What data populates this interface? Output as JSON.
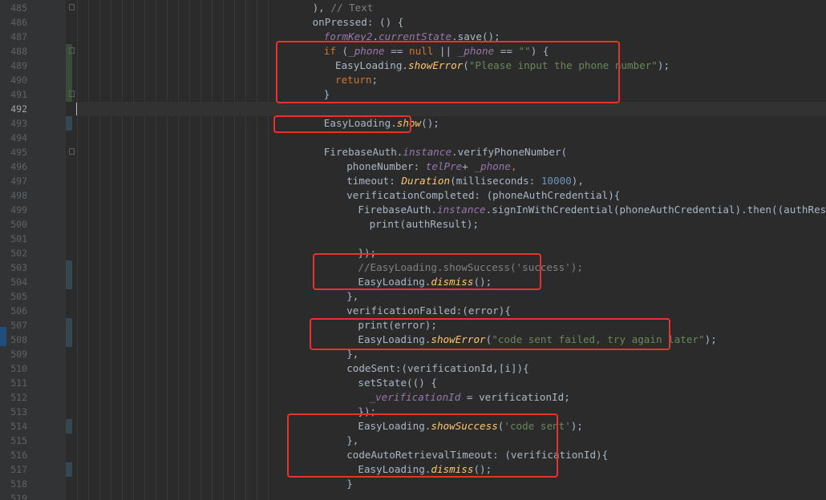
{
  "colors": {
    "default": "#a9b7c6",
    "keyword": "#cc7832",
    "string": "#6a8759",
    "number": "#6897bb",
    "comment": "#808080",
    "static_member": "#9876aa",
    "static_call": "#ffc66d",
    "param_name": "#a9b7c6",
    "highlight_box": "#e8332c"
  },
  "editor": {
    "language": "dart",
    "highlight_boxes": 6,
    "lines": [
      {
        "number": "485",
        "indent": 6,
        "tokens": [
          {
            "t": "), ",
            "k": "default"
          },
          {
            "t": "// Text",
            "k": "comment"
          }
        ]
      },
      {
        "number": "486",
        "indent": 6,
        "tokens": [
          {
            "t": "onPressed: () {",
            "k": "default"
          }
        ]
      },
      {
        "number": "487",
        "indent": 8,
        "tokens": [
          {
            "t": "formKey2",
            "k": "static_member"
          },
          {
            "t": ".",
            "k": "default"
          },
          {
            "t": "currentState",
            "k": "static_member"
          },
          {
            "t": ".save();",
            "k": "default"
          }
        ]
      },
      {
        "number": "488",
        "indent": 8,
        "tokens": [
          {
            "t": "if",
            "k": "keyword"
          },
          {
            "t": " (",
            "k": "default"
          },
          {
            "t": "_phone",
            "k": "static_member"
          },
          {
            "t": " == ",
            "k": "default"
          },
          {
            "t": "null",
            "k": "keyword"
          },
          {
            "t": " || ",
            "k": "default"
          },
          {
            "t": "_phone",
            "k": "static_member"
          },
          {
            "t": " == ",
            "k": "default"
          },
          {
            "t": "\"\"",
            "k": "string"
          },
          {
            "t": ") {",
            "k": "default"
          }
        ]
      },
      {
        "number": "489",
        "indent": 10,
        "tokens": [
          {
            "t": "EasyLoading.",
            "k": "default"
          },
          {
            "t": "showError",
            "k": "static_call"
          },
          {
            "t": "(",
            "k": "default"
          },
          {
            "t": "\"Please input the phone number\"",
            "k": "string"
          },
          {
            "t": ");",
            "k": "default"
          }
        ]
      },
      {
        "number": "490",
        "indent": 10,
        "tokens": [
          {
            "t": "return",
            "k": "keyword"
          },
          {
            "t": ";",
            "k": "default"
          }
        ]
      },
      {
        "number": "491",
        "indent": 8,
        "tokens": [
          {
            "t": "}",
            "k": "default"
          }
        ]
      },
      {
        "number": "492",
        "indent": 0,
        "tokens": [],
        "current": true
      },
      {
        "number": "493",
        "indent": 8,
        "tokens": [
          {
            "t": "EasyLoading.",
            "k": "default"
          },
          {
            "t": "show",
            "k": "static_call"
          },
          {
            "t": "();",
            "k": "default"
          }
        ]
      },
      {
        "number": "494",
        "indent": 0,
        "tokens": []
      },
      {
        "number": "495",
        "indent": 8,
        "tokens": [
          {
            "t": "FirebaseAuth.",
            "k": "default"
          },
          {
            "t": "instance",
            "k": "static_member"
          },
          {
            "t": ".verifyPhoneNumber(",
            "k": "default"
          }
        ]
      },
      {
        "number": "496",
        "indent": 12,
        "tokens": [
          {
            "t": "phoneNumber: ",
            "k": "param_name"
          },
          {
            "t": "telPre",
            "k": "static_member"
          },
          {
            "t": "+ ",
            "k": "default"
          },
          {
            "t": "_phone",
            "k": "static_member"
          },
          {
            "t": ",",
            "k": "keyword"
          }
        ]
      },
      {
        "number": "497",
        "indent": 12,
        "tokens": [
          {
            "t": "timeout: ",
            "k": "param_name"
          },
          {
            "t": "Duration",
            "k": "static_call"
          },
          {
            "t": "(milliseconds: ",
            "k": "default"
          },
          {
            "t": "10000",
            "k": "number"
          },
          {
            "t": "),",
            "k": "default"
          }
        ]
      },
      {
        "number": "498",
        "indent": 12,
        "tokens": [
          {
            "t": "verificationCompleted: (phoneAuthCredential){",
            "k": "default"
          }
        ]
      },
      {
        "number": "499",
        "indent": 14,
        "tokens": [
          {
            "t": "FirebaseAuth.",
            "k": "default"
          },
          {
            "t": "instance",
            "k": "static_member"
          },
          {
            "t": ".signInWithCredential(phoneAuthCredential).then((authResult) {",
            "k": "default"
          }
        ]
      },
      {
        "number": "500",
        "indent": 16,
        "tokens": [
          {
            "t": "print(authResult);",
            "k": "default"
          }
        ]
      },
      {
        "number": "501",
        "indent": 0,
        "tokens": []
      },
      {
        "number": "502",
        "indent": 14,
        "tokens": [
          {
            "t": "});",
            "k": "default"
          }
        ]
      },
      {
        "number": "503",
        "indent": 14,
        "tokens": [
          {
            "t": "//EasyLoading.showSuccess('success');",
            "k": "comment"
          }
        ]
      },
      {
        "number": "504",
        "indent": 14,
        "tokens": [
          {
            "t": "EasyLoading.",
            "k": "default"
          },
          {
            "t": "dismiss",
            "k": "static_call"
          },
          {
            "t": "();",
            "k": "default"
          }
        ]
      },
      {
        "number": "505",
        "indent": 12,
        "tokens": [
          {
            "t": "},",
            "k": "default"
          }
        ]
      },
      {
        "number": "506",
        "indent": 12,
        "tokens": [
          {
            "t": "verificationFailed:(error){",
            "k": "default"
          }
        ]
      },
      {
        "number": "507",
        "indent": 14,
        "tokens": [
          {
            "t": "print(error);",
            "k": "default"
          }
        ]
      },
      {
        "number": "508",
        "indent": 14,
        "tokens": [
          {
            "t": "EasyLoading.",
            "k": "default"
          },
          {
            "t": "showError",
            "k": "static_call"
          },
          {
            "t": "(",
            "k": "default"
          },
          {
            "t": "\"code sent failed, try again later\"",
            "k": "string"
          },
          {
            "t": ");",
            "k": "default"
          }
        ]
      },
      {
        "number": "509",
        "indent": 12,
        "tokens": [
          {
            "t": "},",
            "k": "default"
          }
        ]
      },
      {
        "number": "510",
        "indent": 12,
        "tokens": [
          {
            "t": "codeSent:(verificationId,[i]){",
            "k": "default"
          }
        ]
      },
      {
        "number": "511",
        "indent": 14,
        "tokens": [
          {
            "t": "setState(() {",
            "k": "default"
          }
        ]
      },
      {
        "number": "512",
        "indent": 16,
        "tokens": [
          {
            "t": "_verificationId",
            "k": "static_member"
          },
          {
            "t": " = verificationId;",
            "k": "default"
          }
        ]
      },
      {
        "number": "513",
        "indent": 14,
        "tokens": [
          {
            "t": "});",
            "k": "default"
          }
        ]
      },
      {
        "number": "514",
        "indent": 14,
        "tokens": [
          {
            "t": "EasyLoading.",
            "k": "default"
          },
          {
            "t": "showSuccess",
            "k": "static_call"
          },
          {
            "t": "(",
            "k": "default"
          },
          {
            "t": "'code sent'",
            "k": "string"
          },
          {
            "t": ");",
            "k": "default"
          }
        ]
      },
      {
        "number": "515",
        "indent": 12,
        "tokens": [
          {
            "t": "},",
            "k": "default"
          }
        ]
      },
      {
        "number": "516",
        "indent": 12,
        "tokens": [
          {
            "t": "codeAutoRetrievalTimeout: (verificationId){",
            "k": "default"
          }
        ]
      },
      {
        "number": "517",
        "indent": 14,
        "tokens": [
          {
            "t": "EasyLoading.",
            "k": "default"
          },
          {
            "t": "dismiss",
            "k": "static_call"
          },
          {
            "t": "();",
            "k": "default"
          }
        ]
      },
      {
        "number": "518",
        "indent": 12,
        "tokens": [
          {
            "t": "}",
            "k": "default"
          }
        ]
      },
      {
        "number": "519",
        "indent": 0,
        "tokens": []
      }
    ]
  }
}
